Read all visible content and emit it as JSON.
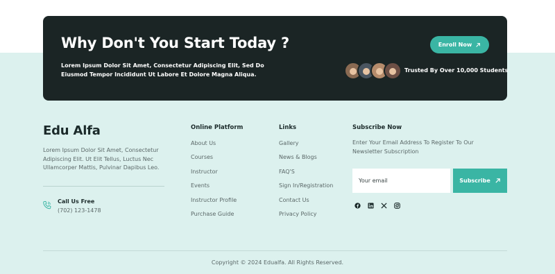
{
  "cta": {
    "title": "Why Don't You Start Today ?",
    "text": "Lorem Ipsum Dolor Sit Amet, Consectetur Adipiscing Elit, Sed Do Eiusmod Tempor Incididunt Ut Labore Et Dolore Magna Aliqua.",
    "enroll_label": "Enroll Now",
    "trusted_text": "Trusted By Over 10,000 Students",
    "avatar_colors": [
      "#8a6a52",
      "#4a5560",
      "#b58b6b",
      "#6d4f45"
    ]
  },
  "brand": {
    "name": "Edu Alfa",
    "description": "Lorem Ipsum Dolor Sit Amet, Consectetur Adipiscing Elit. Ut Elit Tellus, Luctus Nec Ullamcorper Mattis, Pulvinar Dapibus Leo.",
    "call_label": "Call Us Free",
    "phone": "(702) 123-1478"
  },
  "online_platform": {
    "title": "Online Platform",
    "items": [
      "About Us",
      "Courses",
      "Instructor",
      "Events",
      "Instructor Profile",
      "Purchase Guide"
    ]
  },
  "links": {
    "title": "Links",
    "items": [
      "Gallery",
      "News & Blogs",
      "FAQ'S",
      "Sign In/Registration",
      "Contact Us",
      "Privacy Policy"
    ]
  },
  "subscribe": {
    "title": "Subscribe Now",
    "description": "Enter Your Email Address To Register To Our Newsletter Subscription",
    "input_placeholder": "Your email",
    "button_label": "Subscribe",
    "socials": [
      "facebook-icon",
      "linkedin-icon",
      "x-icon",
      "instagram-icon"
    ]
  },
  "copyright": "Copyright © 2024 Edualfa. All Rights Reserved.",
  "colors": {
    "accent": "#3ab5a4",
    "dark": "#1b2525",
    "footer_bg": "#dcf1ee"
  }
}
